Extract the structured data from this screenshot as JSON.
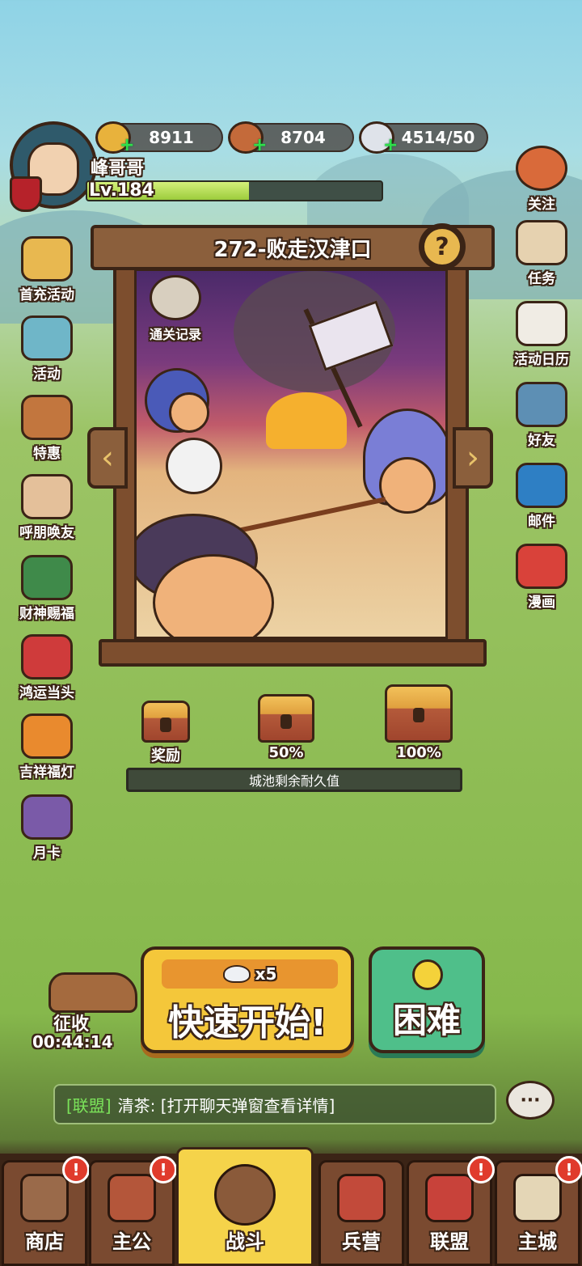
{
  "player": {
    "name": "峰哥哥",
    "level": "Lv.184",
    "exp_fraction": 0.55
  },
  "resources": [
    {
      "icon": "gold-ingot-icon",
      "value": "8911"
    },
    {
      "icon": "copper-coin-icon",
      "value": "8704"
    },
    {
      "icon": "rice-bowl-icon",
      "value": "4514/50"
    }
  ],
  "left_menu": [
    {
      "icon": "first-recharge-icon",
      "label": "首充活动"
    },
    {
      "icon": "event-chest-icon",
      "label": "活动"
    },
    {
      "icon": "discount-basket-icon",
      "label": "特惠"
    },
    {
      "icon": "invite-friend-icon",
      "label": "呼朋唤友"
    },
    {
      "icon": "fortune-god-icon",
      "label": "财神赐福"
    },
    {
      "icon": "lucky-bag-icon",
      "label": "鸿运当头"
    },
    {
      "icon": "lantern-icon",
      "label": "吉祥福灯"
    },
    {
      "icon": "monthly-card-icon",
      "label": "月卡"
    }
  ],
  "right_menu": [
    {
      "icon": "follow-icon",
      "label": "关注"
    },
    {
      "icon": "quest-scroll-icon",
      "label": "任务"
    },
    {
      "icon": "calendar-icon",
      "label": "活动日历"
    },
    {
      "icon": "friends-icon",
      "label": "好友"
    },
    {
      "icon": "mail-icon",
      "label": "邮件"
    },
    {
      "icon": "comic-icon",
      "label": "漫画"
    }
  ],
  "stage": {
    "title": "272-败走汉津口",
    "clear_record_label": "通关记录"
  },
  "rewards": [
    {
      "label": "奖励"
    },
    {
      "label": "50%"
    },
    {
      "label": "100%"
    }
  ],
  "durability_label": "城池剩余耐久值",
  "collect": {
    "label": "征收",
    "timer": "00:44:14"
  },
  "start_button": {
    "cost": "x5",
    "label": "快速开始!"
  },
  "hard_button": {
    "label": "困难"
  },
  "chat": {
    "channel": "[联盟]",
    "message": "清茶: [打开聊天弹窗查看详情]"
  },
  "tabs": [
    {
      "label": "商店",
      "icon": "shop-icon",
      "badge": "!"
    },
    {
      "label": "主公",
      "icon": "lord-icon",
      "badge": "!"
    },
    {
      "label": "战斗",
      "icon": "crossed-swords-icon"
    },
    {
      "label": "兵营",
      "icon": "barracks-icon"
    },
    {
      "label": "联盟",
      "icon": "alliance-banner-icon",
      "badge": "!"
    },
    {
      "label": "主城",
      "icon": "main-city-map-icon",
      "badge": "!"
    }
  ]
}
